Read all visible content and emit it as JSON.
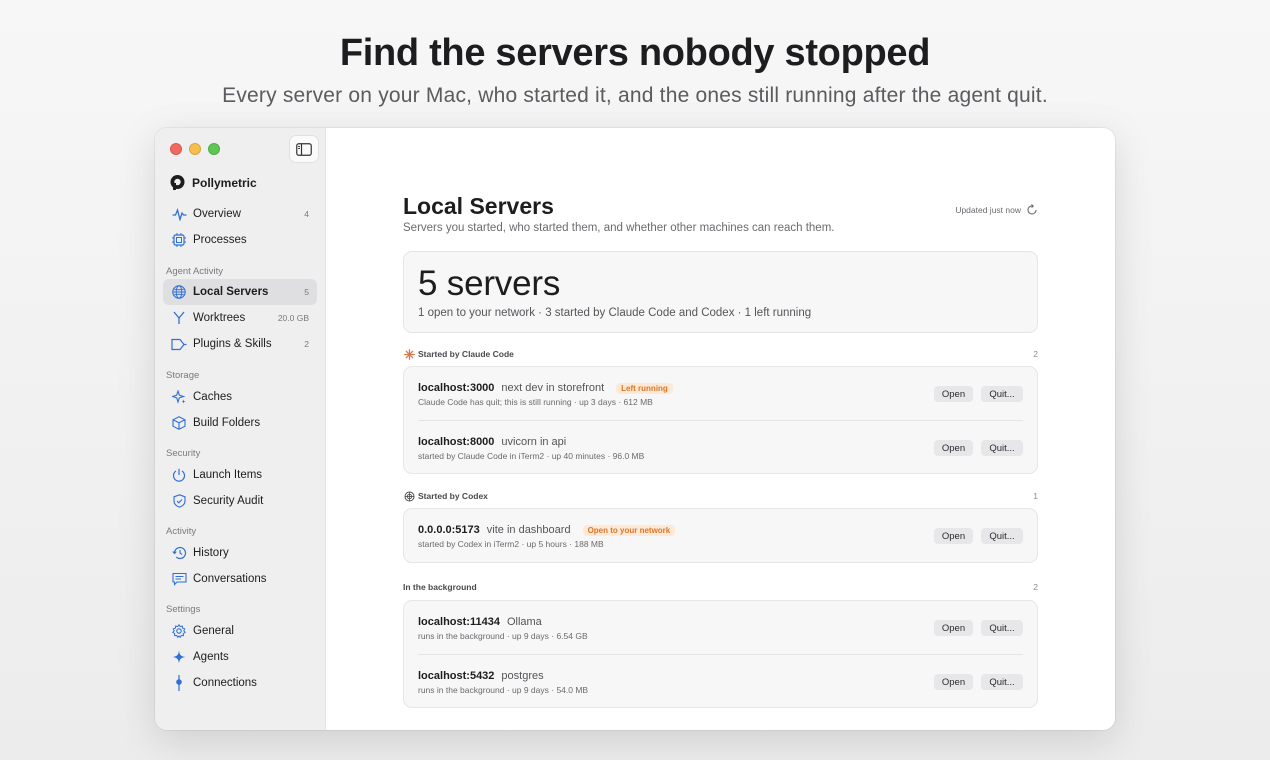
{
  "hero": {
    "title": "Find the servers nobody stopped",
    "subtitle": "Every server on your Mac, who started it, and the ones still running after the agent quit."
  },
  "app": {
    "name": "Pollymetric"
  },
  "sidebar": {
    "top_items": [
      {
        "label": "Overview",
        "count": "4",
        "icon": "pulse-icon"
      },
      {
        "label": "Processes",
        "count": "",
        "icon": "chip-icon"
      }
    ],
    "groups": [
      {
        "title": "Agent Activity",
        "items": [
          {
            "label": "Local Servers",
            "count": "5",
            "icon": "globe-icon",
            "active": true
          },
          {
            "label": "Worktrees",
            "count": "20.0 GB",
            "icon": "branch-icon"
          },
          {
            "label": "Plugins & Skills",
            "count": "2",
            "icon": "plugin-icon"
          }
        ]
      },
      {
        "title": "Storage",
        "items": [
          {
            "label": "Caches",
            "count": "",
            "icon": "sparkle-icon"
          },
          {
            "label": "Build Folders",
            "count": "",
            "icon": "box-icon"
          }
        ]
      },
      {
        "title": "Security",
        "items": [
          {
            "label": "Launch Items",
            "count": "",
            "icon": "power-icon"
          },
          {
            "label": "Security Audit",
            "count": "",
            "icon": "shield-icon"
          }
        ]
      },
      {
        "title": "Activity",
        "items": [
          {
            "label": "History",
            "count": "",
            "icon": "history-icon"
          },
          {
            "label": "Conversations",
            "count": "",
            "icon": "chat-icon"
          }
        ]
      },
      {
        "title": "Settings",
        "items": [
          {
            "label": "General",
            "count": "",
            "icon": "gear-icon"
          },
          {
            "label": "Agents",
            "count": "",
            "icon": "star-icon"
          },
          {
            "label": "Connections",
            "count": "",
            "icon": "connection-icon"
          }
        ]
      }
    ]
  },
  "main": {
    "title": "Local Servers",
    "subtitle": "Servers you started, who started them, and whether other machines can reach them.",
    "updated": "Updated just now",
    "summary": {
      "count": "5 servers",
      "detail": "1 open to your network · 3 started by Claude Code and Codex · 1 left running"
    },
    "sections": [
      {
        "label": "Started by Claude Code",
        "count": "2",
        "icon": "claude-icon",
        "rows": [
          {
            "host": "localhost:3000",
            "desc": "next dev in storefront",
            "badge": "Left running",
            "meta": "Claude Code has quit; this is still running · up 3 days · 612 MB"
          },
          {
            "host": "localhost:8000",
            "desc": "uvicorn in api",
            "badge": "",
            "meta": "started by Claude Code in iTerm2 · up 40 minutes · 96.0 MB"
          }
        ]
      },
      {
        "label": "Started by Codex",
        "count": "1",
        "icon": "codex-icon",
        "rows": [
          {
            "host": "0.0.0.0:5173",
            "desc": "vite in dashboard",
            "badge": "Open to your network",
            "meta": "started by Codex in iTerm2 · up 5 hours · 188 MB"
          }
        ]
      },
      {
        "label": "In the background",
        "count": "2",
        "icon": "",
        "rows": [
          {
            "host": "localhost:11434",
            "desc": "Ollama",
            "badge": "",
            "meta": "runs in the background · up 9 days · 6.54 GB"
          },
          {
            "host": "localhost:5432",
            "desc": "postgres",
            "badge": "",
            "meta": "runs in the background · up 9 days · 54.0 MB"
          }
        ]
      }
    ],
    "buttons": {
      "open": "Open",
      "quit": "Quit..."
    }
  },
  "colors": {
    "accent": "#2f6fd6",
    "badge_bg": "#fde9d6",
    "badge_fg": "#d9772b",
    "claude": "#d9774b"
  }
}
